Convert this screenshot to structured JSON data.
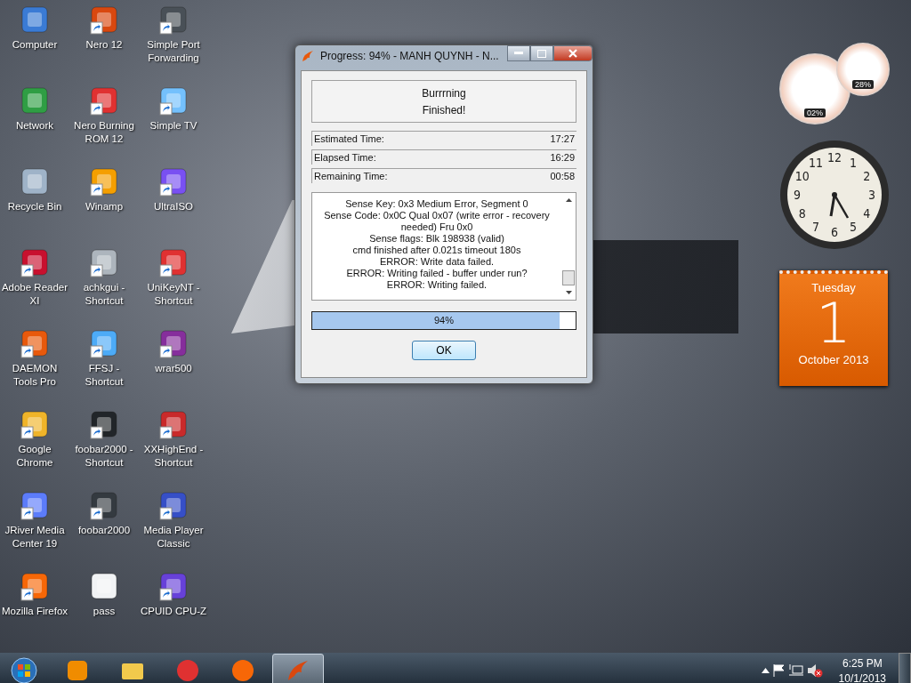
{
  "desktop_icons": [
    {
      "label": "Computer",
      "shortcut": false,
      "color": "#3a7bd5"
    },
    {
      "label": "Network",
      "shortcut": false,
      "color": "#2f9e44"
    },
    {
      "label": "Recycle Bin",
      "shortcut": false,
      "color": "#9fb3c8"
    },
    {
      "label": "Adobe Reader XI",
      "shortcut": true,
      "color": "#c8102e"
    },
    {
      "label": "DAEMON Tools Pro",
      "shortcut": true,
      "color": "#e8590c"
    },
    {
      "label": "Google Chrome",
      "shortcut": true,
      "color": "#f0b429"
    },
    {
      "label": "JRiver Media Center 19",
      "shortcut": true,
      "color": "#5c7cfa"
    },
    {
      "label": "Mozilla Firefox",
      "shortcut": true,
      "color": "#f76707"
    },
    {
      "label": "Nero 12",
      "shortcut": true,
      "color": "#d9480f"
    },
    {
      "label": "Nero Burning ROM 12",
      "shortcut": true,
      "color": "#e03131"
    },
    {
      "label": "Winamp",
      "shortcut": true,
      "color": "#f59f00"
    },
    {
      "label": "achkgui - Shortcut",
      "shortcut": true,
      "color": "#adb5bd"
    },
    {
      "label": "FFSJ - Shortcut",
      "shortcut": true,
      "color": "#4dabf7"
    },
    {
      "label": "foobar2000 - Shortcut",
      "shortcut": true,
      "color": "#212529"
    },
    {
      "label": "foobar2000",
      "shortcut": true,
      "color": "#343a40"
    },
    {
      "label": "pass",
      "shortcut": false,
      "color": "#f1f3f5"
    },
    {
      "label": "Simple Port Forwarding",
      "shortcut": true,
      "color": "#495057"
    },
    {
      "label": "Simple TV",
      "shortcut": true,
      "color": "#74c0fc"
    },
    {
      "label": "UltraISO",
      "shortcut": true,
      "color": "#7950f2"
    },
    {
      "label": "UniKeyNT - Shortcut",
      "shortcut": true,
      "color": "#e03131"
    },
    {
      "label": "wrar500",
      "shortcut": true,
      "color": "#862e9c"
    },
    {
      "label": "XXHighEnd - Shortcut",
      "shortcut": true,
      "color": "#c92a2a"
    },
    {
      "label": "Media Player Classic",
      "shortcut": true,
      "color": "#364fc7"
    },
    {
      "label": "CPUID CPU-Z",
      "shortcut": true,
      "color": "#6741d9"
    }
  ],
  "dialog": {
    "title": "Progress: 94% - MANH QUYNH - N...",
    "status_lines": [
      "Burrrning",
      "Finished!"
    ],
    "times": [
      {
        "label": "Estimated Time:",
        "value": "17:27"
      },
      {
        "label": "Elapsed Time:",
        "value": "16:29"
      },
      {
        "label": "Remaining Time:",
        "value": "00:58"
      }
    ],
    "log_lines": [
      "Sense Key: 0x3 Medium Error, Segment 0",
      "Sense Code: 0x0C Qual 0x07 (write error - recovery needed) Fru 0x0",
      "Sense flags: Blk 198938 (valid)",
      "cmd finished after 0.021s timeout 180s",
      "ERROR: Write data failed.",
      "ERROR: Writing failed - buffer under run?",
      "ERROR: Writing failed."
    ],
    "progress": {
      "level": 0.94,
      "label": "94%"
    },
    "button": "OK"
  },
  "gadgets": {
    "cpu": "02%",
    "memory": "28%",
    "clock_numbers": [
      "12",
      "11",
      "1",
      "10",
      "2",
      "9",
      "3",
      "8",
      "4",
      "7",
      "5",
      "6"
    ],
    "calendar": {
      "weekday": "Tuesday",
      "day": "1",
      "month_year": "October 2013"
    }
  },
  "taskbar": {
    "apps": [
      {
        "kind": "media",
        "selected": false
      },
      {
        "kind": "folder",
        "selected": false
      },
      {
        "kind": "chrome",
        "selected": false
      },
      {
        "kind": "firefox",
        "selected": false
      },
      {
        "kind": "nero",
        "selected": true
      }
    ],
    "time": "6:25 PM",
    "date": "10/1/2013"
  }
}
